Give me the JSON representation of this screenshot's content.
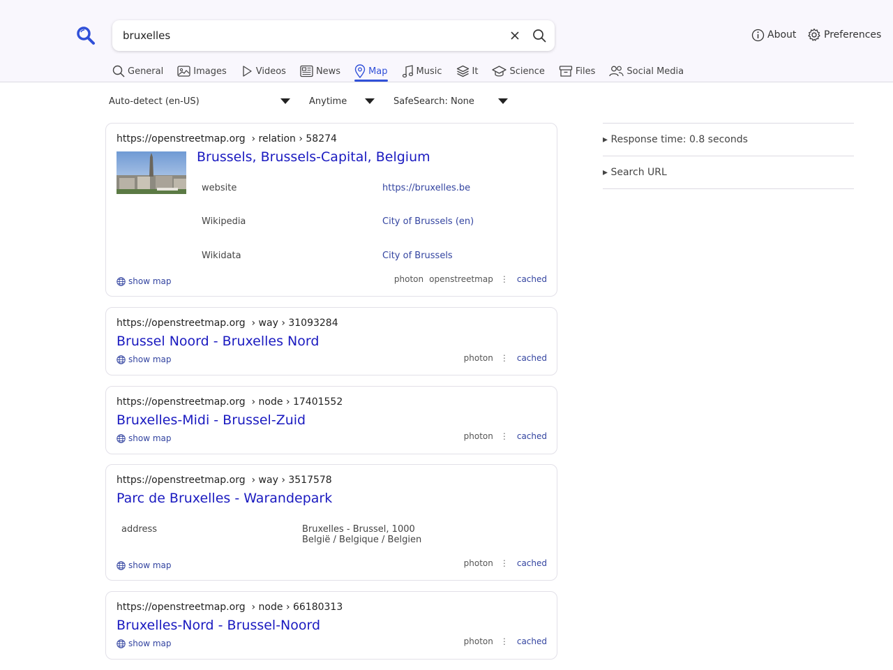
{
  "search": {
    "query": "bruxelles"
  },
  "nav": {
    "about": "About",
    "preferences": "Preferences"
  },
  "tabs": [
    {
      "label": "General",
      "icon": "search-icon"
    },
    {
      "label": "Images",
      "icon": "image-icon"
    },
    {
      "label": "Videos",
      "icon": "play-icon"
    },
    {
      "label": "News",
      "icon": "newspaper-icon"
    },
    {
      "label": "Map",
      "icon": "map-pin-icon",
      "active": true
    },
    {
      "label": "Music",
      "icon": "music-icon"
    },
    {
      "label": "It",
      "icon": "layers-icon"
    },
    {
      "label": "Science",
      "icon": "graduation-cap-icon"
    },
    {
      "label": "Files",
      "icon": "archive-icon"
    },
    {
      "label": "Social Media",
      "icon": "people-icon"
    }
  ],
  "filters": {
    "language": "Auto-detect (en-US)",
    "time": "Anytime",
    "safesearch": "SafeSearch: None"
  },
  "results": [
    {
      "url": "https://openstreetmap.org",
      "path": "› relation › 58274",
      "title": "Brussels, Brussels-Capital, Belgium",
      "fields": [
        {
          "key": "website",
          "value": "https://bruxelles.be"
        },
        {
          "key": "Wikipedia",
          "value": "City of Brussels (en)"
        },
        {
          "key": "Wikidata",
          "value": "City of Brussels"
        }
      ],
      "show_map": "show map",
      "engines": [
        "photon",
        "openstreetmap"
      ],
      "cached": "cached"
    },
    {
      "url": "https://openstreetmap.org",
      "path": "› way › 31093284",
      "title": "Brussel Noord - Bruxelles Nord",
      "show_map": "show map",
      "engines": [
        "photon"
      ],
      "cached": "cached"
    },
    {
      "url": "https://openstreetmap.org",
      "path": "› node › 17401552",
      "title": "Bruxelles-Midi - Brussel-Zuid",
      "show_map": "show map",
      "engines": [
        "photon"
      ],
      "cached": "cached"
    },
    {
      "url": "https://openstreetmap.org",
      "path": "› way › 3517578",
      "title": "Parc de Bruxelles - Warandepark",
      "address_key": "address",
      "address_line1": "Bruxelles - Brussel, 1000",
      "address_line2": "België / Belgique / Belgien",
      "show_map": "show map",
      "engines": [
        "photon"
      ],
      "cached": "cached"
    },
    {
      "url": "https://openstreetmap.org",
      "path": "› node › 66180313",
      "title": "Bruxelles-Nord - Brussel-Noord",
      "show_map": "show map",
      "engines": [
        "photon"
      ],
      "cached": "cached"
    }
  ],
  "sidebar": {
    "response_time": "▸ Response time: 0.8 seconds",
    "search_url": "▸ Search URL"
  }
}
